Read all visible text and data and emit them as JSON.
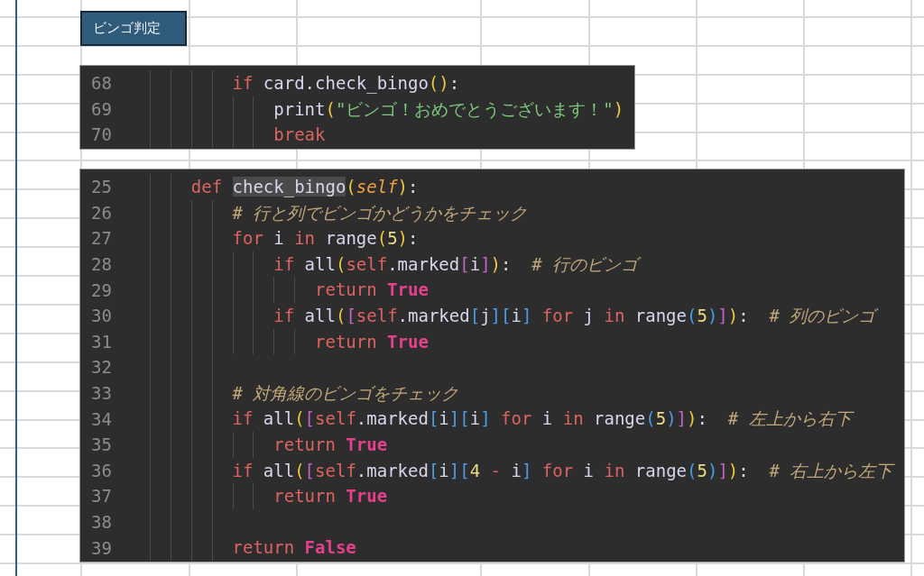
{
  "button": {
    "label": "ビンゴ判定"
  },
  "code_blocks": [
    {
      "lines": [
        {
          "number": "68",
          "tokens": [
            {
              "kind": "keyword",
              "text": "        if"
            },
            {
              "kind": "text",
              "text": " card.check_bingo"
            },
            {
              "kind": "paren",
              "text": "()"
            },
            {
              "kind": "text",
              "text": ":"
            }
          ]
        },
        {
          "number": "69",
          "tokens": [
            {
              "kind": "text",
              "text": "            print"
            },
            {
              "kind": "paren",
              "text": "("
            },
            {
              "kind": "string",
              "text": "\"ビンゴ！おめでとうございます！\""
            },
            {
              "kind": "paren",
              "text": ")"
            }
          ]
        },
        {
          "number": "70",
          "tokens": [
            {
              "kind": "keyword",
              "text": "            break"
            }
          ]
        }
      ]
    },
    {
      "lines": [
        {
          "number": "25",
          "tokens": [
            {
              "kind": "keyword",
              "text": "    def "
            },
            {
              "kind": "highlight",
              "text": "check_bingo"
            },
            {
              "kind": "paren",
              "text": "("
            },
            {
              "kind": "param",
              "text": "self"
            },
            {
              "kind": "paren",
              "text": ")"
            },
            {
              "kind": "text",
              "text": ":"
            }
          ]
        },
        {
          "number": "26",
          "tokens": [
            {
              "kind": "comment",
              "text": "        # 行と列でビンゴかどうかをチェック"
            }
          ]
        },
        {
          "number": "27",
          "tokens": [
            {
              "kind": "keyword",
              "text": "        for"
            },
            {
              "kind": "text",
              "text": " i "
            },
            {
              "kind": "keyword",
              "text": "in"
            },
            {
              "kind": "text",
              "text": " range"
            },
            {
              "kind": "paren",
              "text": "("
            },
            {
              "kind": "number",
              "text": "5"
            },
            {
              "kind": "paren",
              "text": ")"
            },
            {
              "kind": "text",
              "text": ":"
            }
          ]
        },
        {
          "number": "28",
          "tokens": [
            {
              "kind": "keyword",
              "text": "            if"
            },
            {
              "kind": "text",
              "text": " all"
            },
            {
              "kind": "paren",
              "text": "("
            },
            {
              "kind": "keyword",
              "text": "self"
            },
            {
              "kind": "text",
              "text": ".marked"
            },
            {
              "kind": "bracket",
              "text": "["
            },
            {
              "kind": "text",
              "text": "i"
            },
            {
              "kind": "bracket",
              "text": "]"
            },
            {
              "kind": "paren",
              "text": ")"
            },
            {
              "kind": "text",
              "text": ":"
            },
            {
              "kind": "comment",
              "text": "  # 行のビンゴ"
            }
          ]
        },
        {
          "number": "29",
          "tokens": [
            {
              "kind": "keyword",
              "text": "                return "
            },
            {
              "kind": "constant",
              "text": "True"
            }
          ]
        },
        {
          "number": "30",
          "tokens": [
            {
              "kind": "keyword",
              "text": "            if"
            },
            {
              "kind": "text",
              "text": " all"
            },
            {
              "kind": "paren",
              "text": "("
            },
            {
              "kind": "bracket",
              "text": "["
            },
            {
              "kind": "keyword",
              "text": "self"
            },
            {
              "kind": "text",
              "text": ".marked"
            },
            {
              "kind": "index",
              "text": "["
            },
            {
              "kind": "text",
              "text": "j"
            },
            {
              "kind": "index",
              "text": "]["
            },
            {
              "kind": "text",
              "text": "i"
            },
            {
              "kind": "index",
              "text": "]"
            },
            {
              "kind": "keyword",
              "text": " for"
            },
            {
              "kind": "text",
              "text": " j "
            },
            {
              "kind": "keyword",
              "text": "in"
            },
            {
              "kind": "text",
              "text": " range"
            },
            {
              "kind": "index",
              "text": "("
            },
            {
              "kind": "number",
              "text": "5"
            },
            {
              "kind": "index",
              "text": ")"
            },
            {
              "kind": "bracket",
              "text": "]"
            },
            {
              "kind": "paren",
              "text": ")"
            },
            {
              "kind": "text",
              "text": ":"
            },
            {
              "kind": "comment",
              "text": "  # 列のビンゴ"
            }
          ]
        },
        {
          "number": "31",
          "tokens": [
            {
              "kind": "keyword",
              "text": "                return "
            },
            {
              "kind": "constant",
              "text": "True"
            }
          ]
        },
        {
          "number": "32"
        },
        {
          "number": "33",
          "tokens": [
            {
              "kind": "comment",
              "text": "        # 対角線のビンゴをチェック"
            }
          ]
        },
        {
          "number": "34",
          "tokens": [
            {
              "kind": "keyword",
              "text": "        if"
            },
            {
              "kind": "text",
              "text": " all"
            },
            {
              "kind": "paren",
              "text": "("
            },
            {
              "kind": "bracket",
              "text": "["
            },
            {
              "kind": "keyword",
              "text": "self"
            },
            {
              "kind": "text",
              "text": ".marked"
            },
            {
              "kind": "index",
              "text": "["
            },
            {
              "kind": "text",
              "text": "i"
            },
            {
              "kind": "index",
              "text": "]["
            },
            {
              "kind": "text",
              "text": "i"
            },
            {
              "kind": "index",
              "text": "]"
            },
            {
              "kind": "keyword",
              "text": " for"
            },
            {
              "kind": "text",
              "text": " i "
            },
            {
              "kind": "keyword",
              "text": "in"
            },
            {
              "kind": "text",
              "text": " range"
            },
            {
              "kind": "index",
              "text": "("
            },
            {
              "kind": "number",
              "text": "5"
            },
            {
              "kind": "index",
              "text": ")"
            },
            {
              "kind": "bracket",
              "text": "]"
            },
            {
              "kind": "paren",
              "text": ")"
            },
            {
              "kind": "text",
              "text": ":"
            },
            {
              "kind": "comment",
              "text": "  # 左上から右下"
            }
          ]
        },
        {
          "number": "35",
          "tokens": [
            {
              "kind": "keyword",
              "text": "            return "
            },
            {
              "kind": "constant",
              "text": "True"
            }
          ]
        },
        {
          "number": "36",
          "tokens": [
            {
              "kind": "keyword",
              "text": "        if"
            },
            {
              "kind": "text",
              "text": " all"
            },
            {
              "kind": "paren",
              "text": "("
            },
            {
              "kind": "bracket",
              "text": "["
            },
            {
              "kind": "keyword",
              "text": "self"
            },
            {
              "kind": "text",
              "text": ".marked"
            },
            {
              "kind": "index",
              "text": "["
            },
            {
              "kind": "text",
              "text": "i"
            },
            {
              "kind": "index",
              "text": "]["
            },
            {
              "kind": "number",
              "text": "4"
            },
            {
              "kind": "keyword",
              "text": " -"
            },
            {
              "kind": "text",
              "text": " i"
            },
            {
              "kind": "index",
              "text": "]"
            },
            {
              "kind": "keyword",
              "text": " for"
            },
            {
              "kind": "text",
              "text": " i "
            },
            {
              "kind": "keyword",
              "text": "in"
            },
            {
              "kind": "text",
              "text": " range"
            },
            {
              "kind": "index",
              "text": "("
            },
            {
              "kind": "number",
              "text": "5"
            },
            {
              "kind": "index",
              "text": ")"
            },
            {
              "kind": "bracket",
              "text": "]"
            },
            {
              "kind": "paren",
              "text": ")"
            },
            {
              "kind": "text",
              "text": ":"
            },
            {
              "kind": "comment",
              "text": "  # 右上から左下"
            }
          ]
        },
        {
          "number": "37",
          "tokens": [
            {
              "kind": "keyword",
              "text": "            return "
            },
            {
              "kind": "constant",
              "text": "True"
            }
          ]
        },
        {
          "number": "38"
        },
        {
          "number": "39",
          "tokens": [
            {
              "kind": "keyword",
              "text": "        return "
            },
            {
              "kind": "constant",
              "text": "False"
            }
          ]
        }
      ]
    }
  ]
}
